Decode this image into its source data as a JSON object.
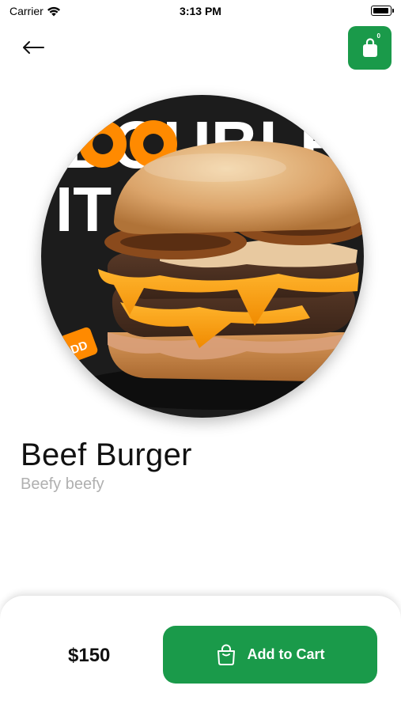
{
  "status_bar": {
    "carrier": "Carrier",
    "time": "3:13 PM"
  },
  "header": {
    "cart_count": "0",
    "accent_color": "#1a9a4a"
  },
  "product": {
    "name": "Beef Burger",
    "description": "Beefy beefy",
    "image_text_top": "DOUBLE",
    "image_text_bottom": "IT",
    "image_badge": "DD"
  },
  "bottom_bar": {
    "price": "$150",
    "add_to_cart_label": "Add to Cart"
  },
  "icons": {
    "back": "arrow-left-icon",
    "cart": "shopping-bag-icon",
    "wifi": "wifi-icon",
    "battery": "battery-icon"
  }
}
